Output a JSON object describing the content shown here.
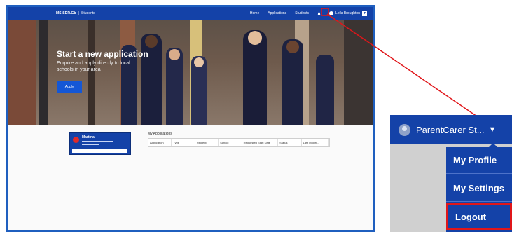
{
  "screenshot": {
    "brand": "MS.SDR.Gb",
    "brand_section": "Students",
    "nav": [
      "Home",
      "Applications",
      "Students"
    ],
    "user_short": "Leila Broughton",
    "hero": {
      "title": "Start a new application",
      "subtitle": "Enquire and apply directly to local schools in your area",
      "button": "Apply"
    },
    "card": {
      "name": "Martina"
    },
    "applications": {
      "title": "My Applications",
      "columns": [
        "Application",
        "Type",
        "Student",
        "School",
        "Requested Start Date",
        "Status",
        "Last Modifi..."
      ]
    }
  },
  "zoom": {
    "user_label": "ParentCarer St...",
    "menu": [
      "My Profile",
      "My Settings",
      "Logout"
    ]
  },
  "colors": {
    "primary": "#1442a8",
    "highlight": "#e0161a"
  },
  "icons": [
    "bell-icon",
    "lock-icon",
    "avatar-icon",
    "caret-down-icon"
  ]
}
